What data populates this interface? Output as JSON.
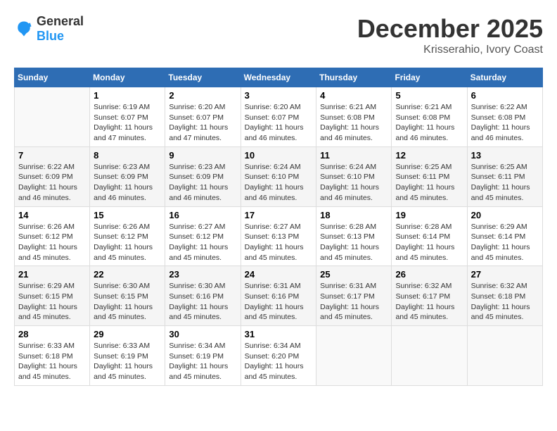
{
  "header": {
    "logo_general": "General",
    "logo_blue": "Blue",
    "month_year": "December 2025",
    "location": "Krisserahio, Ivory Coast"
  },
  "days_of_week": [
    "Sunday",
    "Monday",
    "Tuesday",
    "Wednesday",
    "Thursday",
    "Friday",
    "Saturday"
  ],
  "weeks": [
    [
      {
        "day": "",
        "info": ""
      },
      {
        "day": "1",
        "info": "Sunrise: 6:19 AM\nSunset: 6:07 PM\nDaylight: 11 hours\nand 47 minutes."
      },
      {
        "day": "2",
        "info": "Sunrise: 6:20 AM\nSunset: 6:07 PM\nDaylight: 11 hours\nand 47 minutes."
      },
      {
        "day": "3",
        "info": "Sunrise: 6:20 AM\nSunset: 6:07 PM\nDaylight: 11 hours\nand 46 minutes."
      },
      {
        "day": "4",
        "info": "Sunrise: 6:21 AM\nSunset: 6:08 PM\nDaylight: 11 hours\nand 46 minutes."
      },
      {
        "day": "5",
        "info": "Sunrise: 6:21 AM\nSunset: 6:08 PM\nDaylight: 11 hours\nand 46 minutes."
      },
      {
        "day": "6",
        "info": "Sunrise: 6:22 AM\nSunset: 6:08 PM\nDaylight: 11 hours\nand 46 minutes."
      }
    ],
    [
      {
        "day": "7",
        "info": "Sunrise: 6:22 AM\nSunset: 6:09 PM\nDaylight: 11 hours\nand 46 minutes."
      },
      {
        "day": "8",
        "info": "Sunrise: 6:23 AM\nSunset: 6:09 PM\nDaylight: 11 hours\nand 46 minutes."
      },
      {
        "day": "9",
        "info": "Sunrise: 6:23 AM\nSunset: 6:09 PM\nDaylight: 11 hours\nand 46 minutes."
      },
      {
        "day": "10",
        "info": "Sunrise: 6:24 AM\nSunset: 6:10 PM\nDaylight: 11 hours\nand 46 minutes."
      },
      {
        "day": "11",
        "info": "Sunrise: 6:24 AM\nSunset: 6:10 PM\nDaylight: 11 hours\nand 46 minutes."
      },
      {
        "day": "12",
        "info": "Sunrise: 6:25 AM\nSunset: 6:11 PM\nDaylight: 11 hours\nand 45 minutes."
      },
      {
        "day": "13",
        "info": "Sunrise: 6:25 AM\nSunset: 6:11 PM\nDaylight: 11 hours\nand 45 minutes."
      }
    ],
    [
      {
        "day": "14",
        "info": "Sunrise: 6:26 AM\nSunset: 6:12 PM\nDaylight: 11 hours\nand 45 minutes."
      },
      {
        "day": "15",
        "info": "Sunrise: 6:26 AM\nSunset: 6:12 PM\nDaylight: 11 hours\nand 45 minutes."
      },
      {
        "day": "16",
        "info": "Sunrise: 6:27 AM\nSunset: 6:12 PM\nDaylight: 11 hours\nand 45 minutes."
      },
      {
        "day": "17",
        "info": "Sunrise: 6:27 AM\nSunset: 6:13 PM\nDaylight: 11 hours\nand 45 minutes."
      },
      {
        "day": "18",
        "info": "Sunrise: 6:28 AM\nSunset: 6:13 PM\nDaylight: 11 hours\nand 45 minutes."
      },
      {
        "day": "19",
        "info": "Sunrise: 6:28 AM\nSunset: 6:14 PM\nDaylight: 11 hours\nand 45 minutes."
      },
      {
        "day": "20",
        "info": "Sunrise: 6:29 AM\nSunset: 6:14 PM\nDaylight: 11 hours\nand 45 minutes."
      }
    ],
    [
      {
        "day": "21",
        "info": "Sunrise: 6:29 AM\nSunset: 6:15 PM\nDaylight: 11 hours\nand 45 minutes."
      },
      {
        "day": "22",
        "info": "Sunrise: 6:30 AM\nSunset: 6:15 PM\nDaylight: 11 hours\nand 45 minutes."
      },
      {
        "day": "23",
        "info": "Sunrise: 6:30 AM\nSunset: 6:16 PM\nDaylight: 11 hours\nand 45 minutes."
      },
      {
        "day": "24",
        "info": "Sunrise: 6:31 AM\nSunset: 6:16 PM\nDaylight: 11 hours\nand 45 minutes."
      },
      {
        "day": "25",
        "info": "Sunrise: 6:31 AM\nSunset: 6:17 PM\nDaylight: 11 hours\nand 45 minutes."
      },
      {
        "day": "26",
        "info": "Sunrise: 6:32 AM\nSunset: 6:17 PM\nDaylight: 11 hours\nand 45 minutes."
      },
      {
        "day": "27",
        "info": "Sunrise: 6:32 AM\nSunset: 6:18 PM\nDaylight: 11 hours\nand 45 minutes."
      }
    ],
    [
      {
        "day": "28",
        "info": "Sunrise: 6:33 AM\nSunset: 6:18 PM\nDaylight: 11 hours\nand 45 minutes."
      },
      {
        "day": "29",
        "info": "Sunrise: 6:33 AM\nSunset: 6:19 PM\nDaylight: 11 hours\nand 45 minutes."
      },
      {
        "day": "30",
        "info": "Sunrise: 6:34 AM\nSunset: 6:19 PM\nDaylight: 11 hours\nand 45 minutes."
      },
      {
        "day": "31",
        "info": "Sunrise: 6:34 AM\nSunset: 6:20 PM\nDaylight: 11 hours\nand 45 minutes."
      },
      {
        "day": "",
        "info": ""
      },
      {
        "day": "",
        "info": ""
      },
      {
        "day": "",
        "info": ""
      }
    ]
  ]
}
